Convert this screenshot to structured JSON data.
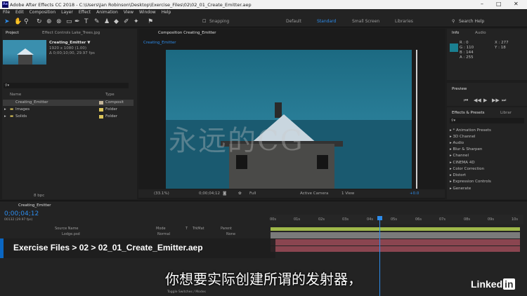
{
  "titlebar": {
    "title": "Adobe After Effects CC 2018 - C:\\Users\\Jan Robinson\\Desktop\\Exercise_Files\\02\\02_01_Create_Emitter.aep",
    "logo": "Ae",
    "minimize": "–",
    "maximize": "□",
    "close": "✕"
  },
  "menu": [
    "File",
    "Edit",
    "Composition",
    "Layer",
    "Effect",
    "Animation",
    "View",
    "Window",
    "Help"
  ],
  "toolbar": {
    "snapping": "Snapping",
    "workspaces": [
      "Default",
      "Standard",
      "Small Screen",
      "Libraries"
    ],
    "active_workspace": "Standard",
    "search_placeholder": "Search Help"
  },
  "project": {
    "tab": "Project",
    "effect_controls_tab": "Effect Controls Lake_Trees.jpg",
    "comp_name": "Creating_Emitter ▼",
    "comp_res": "1920 x 1080 (1.00)",
    "comp_dur": "Δ 0;00;10;00, 29.97 fps",
    "col_name": "Name",
    "col_type": "Type",
    "search_placeholder": "⚲▾",
    "bpc": "8 bpc",
    "items": [
      {
        "name": "Creating_Emitter",
        "type": "Composit",
        "color": "#c4b59a",
        "selected": true
      },
      {
        "name": "Images",
        "type": "Folder",
        "color": "#dcc55a"
      },
      {
        "name": "Solids",
        "type": "Folder",
        "color": "#dcc55a"
      }
    ]
  },
  "comp": {
    "tab": "Composition Creating_Emitter",
    "subtab": "Creating_Emitter",
    "zoom": "(33.1%)",
    "timecode": "0;00;04;12",
    "resolution": "Full",
    "camera": "Active Camera",
    "view": "1 View",
    "exposure": "+0.0"
  },
  "watermark": "永远的CG",
  "info": {
    "tab": "Info",
    "audio_tab": "Audio",
    "r": "R : 0",
    "g": "G : 110",
    "b": "B : 144",
    "a": "A : 255",
    "x": "X : 277",
    "y": "Y : 18",
    "swatch": "#1a7f90"
  },
  "preview": {
    "tab": "Preview"
  },
  "effects": {
    "tab": "Effects & Presets",
    "library_tab": "Librar",
    "search_placeholder": "⚲▾",
    "items": [
      "▸ * Animation Presets",
      "▸ 3D Channel",
      "▸ Audio",
      "▸ Blur & Sharpen",
      "▸ Channel",
      "▸ CINEMA 4D",
      "▸ Color Correction",
      "▸ Distort",
      "▸ Expression Controls",
      "▸ Generate"
    ]
  },
  "timeline": {
    "tab": "Creating_Emitter",
    "timecode": "0;00;04;12",
    "frames": "00132 (29.97 fps)",
    "col_source": "Source Name",
    "col_mode": "Mode",
    "col_t": "T",
    "col_trkmat": "TrkMat",
    "col_parent": "Parent",
    "layer1": "Lodge.psd",
    "layer1_mode": "Normal",
    "layer1_parent": "None",
    "toggle": "Toggle Switches / Modes",
    "ticks": [
      "00s",
      "01s",
      "02s",
      "03s",
      "04s",
      "05s",
      "06s",
      "07s",
      "08s",
      "09s",
      "10s"
    ]
  },
  "breadcrumb": "Exercise Files > 02 > 02_01_Create_Emitter.aep",
  "subtitle": "你想要实际创建所谓的发射器，",
  "linkedin": {
    "text": "Linked",
    "in": "in"
  }
}
